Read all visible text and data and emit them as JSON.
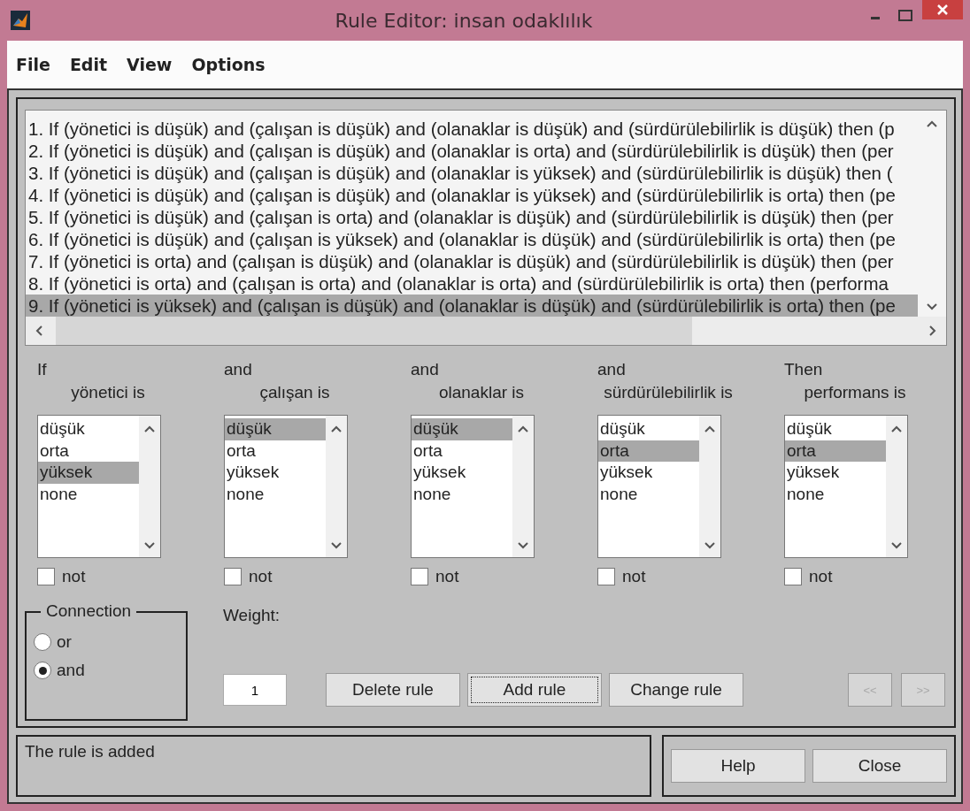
{
  "window": {
    "title": "Rule Editor: insan odaklılık"
  },
  "menu": [
    "File",
    "Edit",
    "View",
    "Options"
  ],
  "rules": [
    {
      "text": "1. If (yönetici is düşük) and (çalışan is düşük) and (olanaklar is düşük) and (sürdürülebilirlik is düşük) then (p",
      "selected": false
    },
    {
      "text": "2. If (yönetici is düşük) and (çalışan is düşük) and (olanaklar is orta) and (sürdürülebilirlik is düşük) then (per",
      "selected": false
    },
    {
      "text": "3. If (yönetici is düşük) and (çalışan is düşük) and (olanaklar is yüksek) and (sürdürülebilirlik is düşük) then (",
      "selected": false
    },
    {
      "text": "4. If (yönetici is düşük) and (çalışan is düşük) and (olanaklar is yüksek) and (sürdürülebilirlik is orta) then (pe",
      "selected": false
    },
    {
      "text": "5. If (yönetici is düşük) and (çalışan is orta) and (olanaklar is düşük) and (sürdürülebilirlik is düşük) then (per",
      "selected": false
    },
    {
      "text": "6. If (yönetici is düşük) and (çalışan is yüksek) and (olanaklar is düşük) and (sürdürülebilirlik is orta) then (pe",
      "selected": false
    },
    {
      "text": "7. If (yönetici is orta) and (çalışan is düşük) and (olanaklar is düşük) and (sürdürülebilirlik is düşük) then (per",
      "selected": false
    },
    {
      "text": "8. If (yönetici is orta) and (çalışan is orta) and (olanaklar is orta) and (sürdürülebilirlik is orta) then (performa",
      "selected": false
    },
    {
      "text": "9. If (yönetici is yüksek) and (çalışan is düşük) and (olanaklar is düşük) and (sürdürülebilirlik is orta) then (pe",
      "selected": true
    }
  ],
  "variables": [
    {
      "connector": "If",
      "label": "yönetici is",
      "options": [
        {
          "label": "düşük",
          "selected": false
        },
        {
          "label": "orta",
          "selected": false
        },
        {
          "label": "yüksek",
          "selected": true
        },
        {
          "label": "none",
          "selected": false
        }
      ],
      "not_label": "not",
      "not_checked": false
    },
    {
      "connector": "and",
      "label": "çalışan is",
      "options": [
        {
          "label": "düşük",
          "selected": true
        },
        {
          "label": "orta",
          "selected": false
        },
        {
          "label": "yüksek",
          "selected": false
        },
        {
          "label": "none",
          "selected": false
        }
      ],
      "not_label": "not",
      "not_checked": false
    },
    {
      "connector": "and",
      "label": "olanaklar is",
      "options": [
        {
          "label": "düşük",
          "selected": true
        },
        {
          "label": "orta",
          "selected": false
        },
        {
          "label": "yüksek",
          "selected": false
        },
        {
          "label": "none",
          "selected": false
        }
      ],
      "not_label": "not",
      "not_checked": false
    },
    {
      "connector": "and",
      "label": "sürdürülebilirlik is",
      "options": [
        {
          "label": "düşük",
          "selected": false
        },
        {
          "label": "orta",
          "selected": true
        },
        {
          "label": "yüksek",
          "selected": false
        },
        {
          "label": "none",
          "selected": false
        }
      ],
      "not_label": "not",
      "not_checked": false
    },
    {
      "connector": "Then",
      "label": "performans is",
      "options": [
        {
          "label": "düşük",
          "selected": false
        },
        {
          "label": "orta",
          "selected": true
        },
        {
          "label": "yüksek",
          "selected": false
        },
        {
          "label": "none",
          "selected": false
        }
      ],
      "not_label": "not",
      "not_checked": false
    }
  ],
  "connection": {
    "label": "Connection",
    "options": [
      {
        "label": "or",
        "selected": false
      },
      {
        "label": "and",
        "selected": true
      }
    ]
  },
  "weight": {
    "label": "Weight:",
    "value": "1"
  },
  "actions": [
    {
      "label": "Delete rule",
      "focused": false
    },
    {
      "label": "Add rule",
      "focused": true
    },
    {
      "label": "Change rule",
      "focused": false
    }
  ],
  "nav": [
    {
      "label": "<<",
      "disabled": true
    },
    {
      "label": ">>",
      "disabled": true
    }
  ],
  "status": "The rule is added",
  "footer_buttons": [
    "Help",
    "Close"
  ]
}
